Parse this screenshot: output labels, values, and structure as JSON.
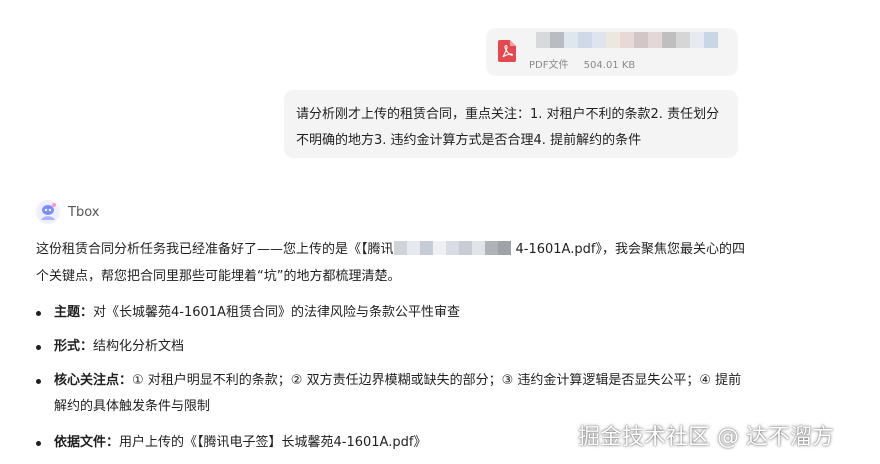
{
  "file": {
    "type_label": "PDF文件",
    "size": "504.01 KB"
  },
  "user_message": "请分析刚才上传的租赁合同，重点关注：1. 对租户不利的条款2. 责任划分不明确的地方3. 违约金计算方式是否合理4. 提前解约的条件",
  "bot": {
    "name": "Tbox",
    "intro_prefix": "这份租赁合同分析任务我已经准备好了——您上传的是《【腾讯",
    "intro_suffix": "4-1601A.pdf》，我会聚焦您最关心的四个关键点，帮您把合同里那些可能埋着“坑”的地方都梳理清楚。",
    "bullets": [
      {
        "label": "主题：",
        "text": "对《长城馨苑4-1601A租赁合同》的法律风险与条款公平性审查"
      },
      {
        "label": "形式：",
        "text": "结构化分析文档"
      },
      {
        "label": "核心关注点：",
        "text": "① 对租户明显不利的条款；② 双方责任边界模糊或缺失的部分；③ 违约金计算逻辑是否显失公平；④ 提前解约的具体触发条件与限制"
      },
      {
        "label": "依据文件：",
        "text": "用户上传的《【腾讯电子签】长城馨苑4-1601A.pdf》"
      }
    ]
  },
  "watermark": "掘金技术社区 @ 达不溜方",
  "colors": {
    "pdf_red": "#e5484d",
    "bubble_bg": "#f4f4f5"
  },
  "icons": {
    "file": "pdf-icon",
    "avatar": "tbox-avatar-icon"
  }
}
